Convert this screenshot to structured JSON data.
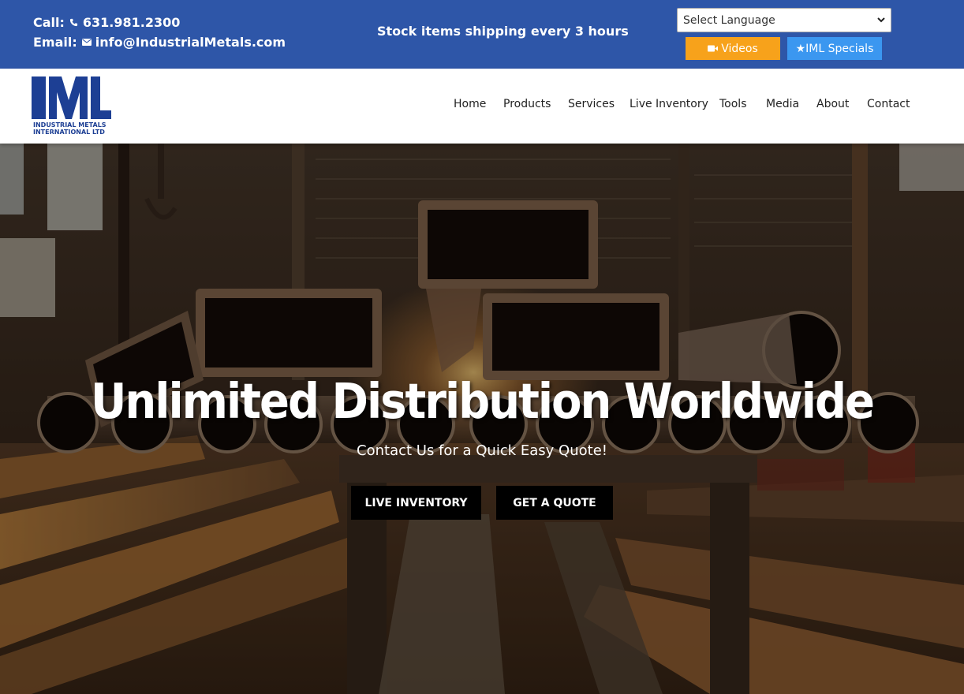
{
  "topbar": {
    "call_label": "Call:",
    "phone": "631.981.2300",
    "email_label": "Email:",
    "email": "info@IndustrialMetals.com",
    "shipping_notice": "Stock items shipping every 3 hours",
    "language_select": "Select Language",
    "videos_label": "Videos",
    "specials_label": "★IML Specials",
    "colors": {
      "bar": "#2e56a8",
      "videos": "#f7a21b",
      "specials": "#3b97f0"
    },
    "icons": {
      "phone": "phone-icon",
      "email": "envelope-icon",
      "videos": "video-camera-icon",
      "select": "chevron-down-icon"
    }
  },
  "logo": {
    "mark": "IML",
    "line1": "INDUSTRIAL METALS",
    "line2": "INTERNATIONAL LTD",
    "color": "#1d3f94"
  },
  "nav": {
    "items": [
      "Home",
      "Products",
      "Services",
      "Live Inventory",
      "Tools",
      "Media",
      "About",
      "Contact"
    ]
  },
  "hero": {
    "title": "Unlimited Distribution Worldwide",
    "subtitle": "Contact Us for a Quick Easy Quote!",
    "buttons": [
      "LIVE INVENTORY",
      "GET A QUOTE"
    ],
    "background_description_icon": "warehouse-metal-tubes-photo"
  }
}
